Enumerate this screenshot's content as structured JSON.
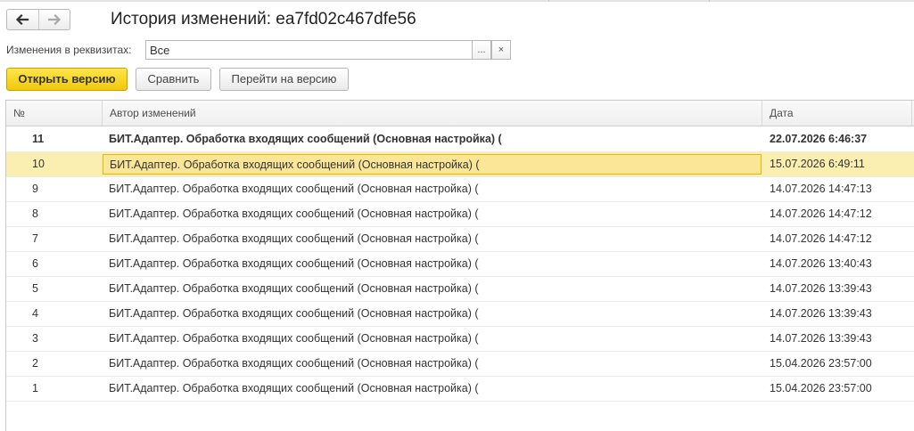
{
  "window": {
    "title": "История изменений: ea7fd02c467dfe56"
  },
  "filter": {
    "label": "Изменения в реквизитах:",
    "value": "Все",
    "more_label": "...",
    "clear_label": "×"
  },
  "toolbar": {
    "open_version_label": "Открыть версию",
    "compare_label": "Сравнить",
    "goto_version_label": "Перейти на версию"
  },
  "table": {
    "columns": [
      "№",
      "Автор изменений",
      "Дата"
    ],
    "rows": [
      {
        "num": "11",
        "author": "БИТ.Адаптер. Обработка входящих сообщений (Основная настройка) (",
        "date": "22.07.2026 6:46:37"
      },
      {
        "num": "10",
        "author": "БИТ.Адаптер. Обработка входящих сообщений (Основная настройка) (",
        "date": "15.07.2026 6:49:11"
      },
      {
        "num": "9",
        "author": "БИТ.Адаптер. Обработка входящих сообщений (Основная настройка) (",
        "date": "14.07.2026 14:47:13"
      },
      {
        "num": "8",
        "author": "БИТ.Адаптер. Обработка входящих сообщений (Основная настройка) (",
        "date": "14.07.2026 14:47:12"
      },
      {
        "num": "7",
        "author": "БИТ.Адаптер. Обработка входящих сообщений (Основная настройка) (",
        "date": "14.07.2026 14:47:12"
      },
      {
        "num": "6",
        "author": "БИТ.Адаптер. Обработка входящих сообщений (Основная настройка) (",
        "date": "14.07.2026 13:40:43"
      },
      {
        "num": "5",
        "author": "БИТ.Адаптер. Обработка входящих сообщений (Основная настройка) (",
        "date": "14.07.2026 13:39:43"
      },
      {
        "num": "4",
        "author": "БИТ.Адаптер. Обработка входящих сообщений (Основная настройка) (",
        "date": "14.07.2026 13:39:43"
      },
      {
        "num": "3",
        "author": "БИТ.Адаптер. Обработка входящих сообщений (Основная настройка) (",
        "date": "14.07.2026 13:39:43"
      },
      {
        "num": "2",
        "author": "БИТ.Адаптер. Обработка входящих сообщений (Основная настройка) (",
        "date": "15.04.2026 23:57:00"
      },
      {
        "num": "1",
        "author": "БИТ.Адаптер. Обработка входящих сообщений (Основная настройка) (",
        "date": "15.04.2026 23:57:00"
      }
    ]
  },
  "colors": {
    "primary_button": "#f5d21f",
    "selected_row": "#fbeeb1",
    "selected_cell_border": "#e6b800"
  },
  "icons": {
    "back": "arrow-left-icon",
    "forward": "arrow-right-icon"
  }
}
